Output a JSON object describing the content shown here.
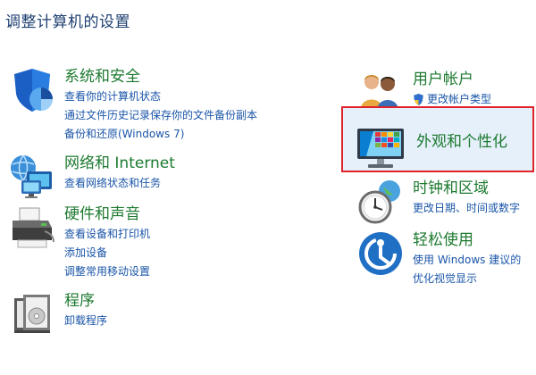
{
  "header": {
    "title": "调整计算机的设置"
  },
  "left_column": [
    {
      "title": "系统和安全",
      "icon": "security-shield-icon",
      "links": [
        "查看你的计算机状态",
        "通过文件历史记录保存你的文件备份副本",
        "备份和还原(Windows 7)"
      ]
    },
    {
      "title": "网络和 Internet",
      "icon": "network-icon",
      "links": [
        "查看网络状态和任务"
      ]
    },
    {
      "title": "硬件和声音",
      "icon": "printer-icon",
      "links": [
        "查看设备和打印机",
        "添加设备",
        "调整常用移动设置"
      ]
    },
    {
      "title": "程序",
      "icon": "programs-icon",
      "links": [
        "卸载程序"
      ]
    }
  ],
  "right_column": [
    {
      "title": "用户帐户",
      "icon": "users-icon",
      "links": [
        "更改帐户类型"
      ]
    },
    {
      "title": "外观和个性化",
      "icon": "appearance-monitor-icon",
      "links": [],
      "highlighted": true,
      "highlight_color": "#e0232a"
    },
    {
      "title": "时钟和区域",
      "icon": "clock-globe-icon",
      "links": [
        "更改日期、时间或数字"
      ]
    },
    {
      "title": "轻松使用",
      "icon": "ease-of-access-icon",
      "links": [
        "使用 Windows 建议的",
        "优化视觉显示"
      ]
    }
  ],
  "colors": {
    "category_title": "#1d7a30",
    "link": "#1a55a8",
    "page_title": "#1e3f70",
    "highlight_border": "#e0232a",
    "highlight_fill": "#e6f0fb"
  }
}
